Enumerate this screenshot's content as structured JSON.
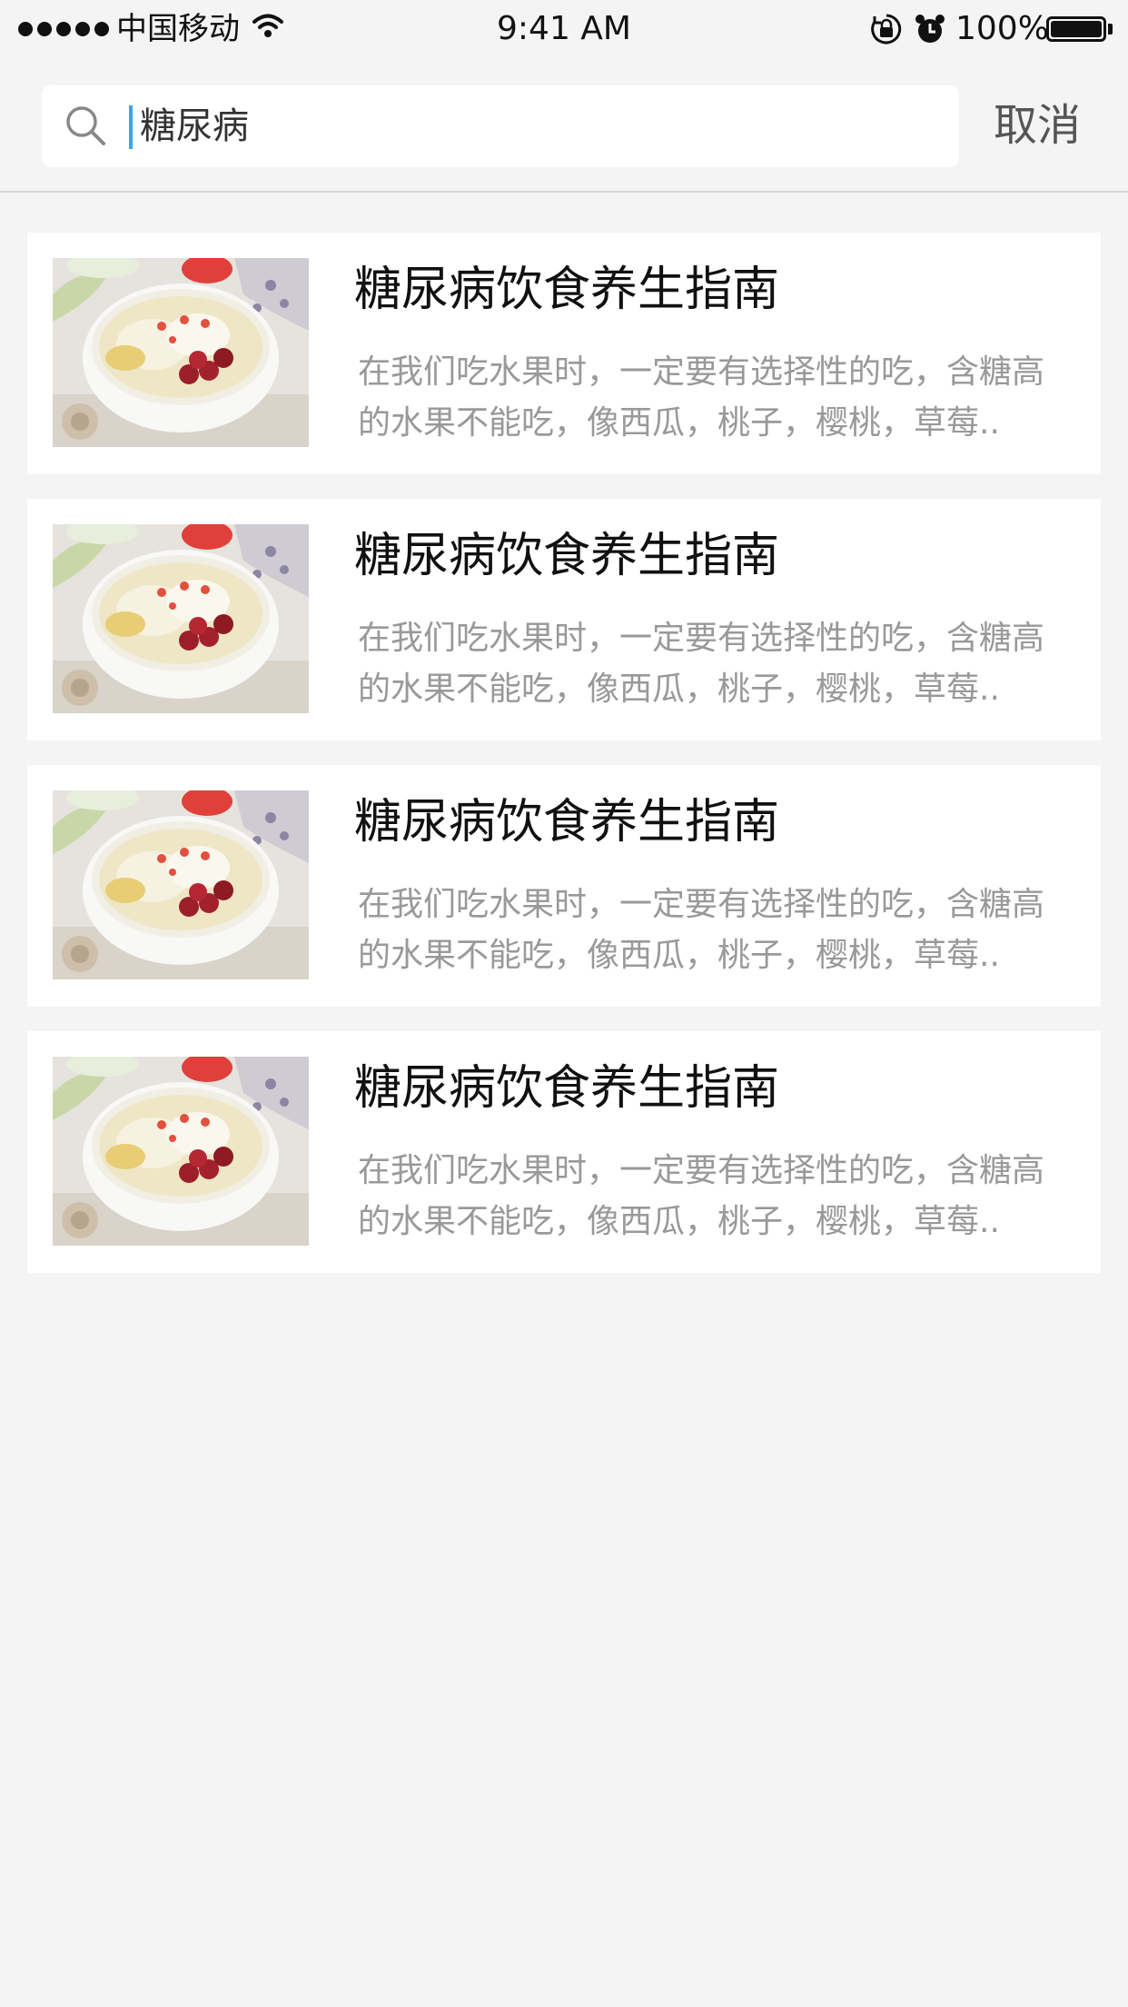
{
  "status_bar": {
    "carrier": "中国移动",
    "time": "9:41 AM",
    "battery": "100%"
  },
  "search": {
    "query": "糖尿病",
    "cancel_label": "取消"
  },
  "results": [
    {
      "title": "糖尿病饮食养生指南",
      "desc_line1": "在我们吃水果时，一定要有选择性的吃，含糖高",
      "desc_line2": "的水果不能吃，像西瓜，桃子，樱桃，草莓.."
    },
    {
      "title": "糖尿病饮食养生指南",
      "desc_line1": "在我们吃水果时，一定要有选择性的吃，含糖高",
      "desc_line2": "的水果不能吃，像西瓜，桃子，樱桃，草莓.."
    },
    {
      "title": "糖尿病饮食养生指南",
      "desc_line1": "在我们吃水果时，一定要有选择性的吃，含糖高",
      "desc_line2": "的水果不能吃，像西瓜，桃子，樱桃，草莓.."
    },
    {
      "title": "糖尿病饮食养生指南",
      "desc_line1": "在我们吃水果时，一定要有选择性的吃，含糖高",
      "desc_line2": "的水果不能吃，像西瓜，桃子，樱桃，草莓.."
    }
  ],
  "colors": {
    "background": "#f3f4f3",
    "caret": "#3aa7e2",
    "title": "#111111",
    "description": "#999999"
  }
}
